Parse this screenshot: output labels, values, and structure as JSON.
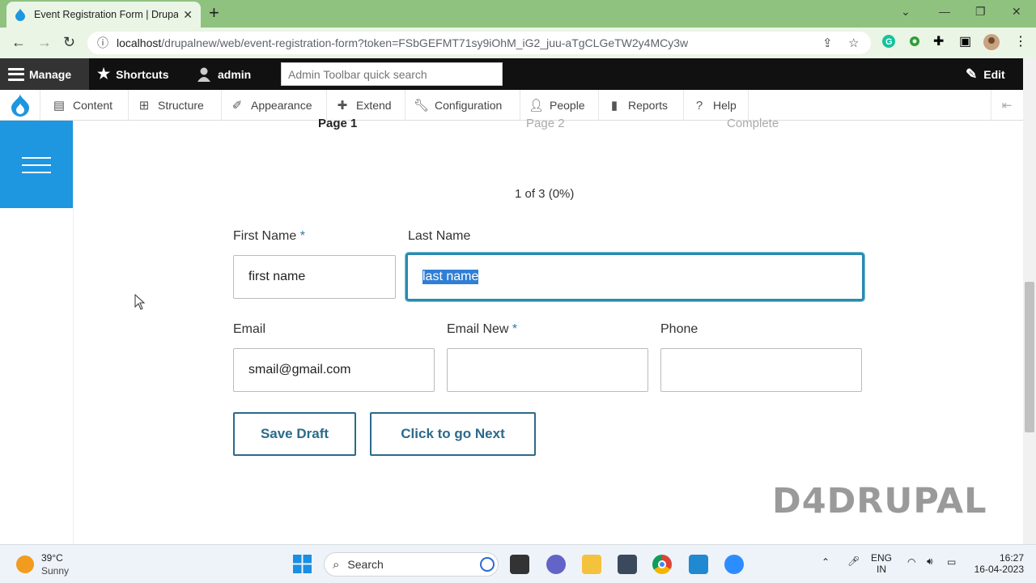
{
  "browser": {
    "tab_title": "Event Registration Form | Drupal",
    "url_host": "localhost",
    "url_rest": "/drupalnew/web/event-registration-form?token=FSbGEFMT71sy9iOhM_iG2_juu-aTgCLGeTW2y4MCy3w"
  },
  "toolbar": {
    "manage": "Manage",
    "shortcuts": "Shortcuts",
    "user": "admin",
    "search_placeholder": "Admin Toolbar quick search",
    "edit": "Edit"
  },
  "subtoolbar": {
    "items": [
      "Content",
      "Structure",
      "Appearance",
      "Extend",
      "Configuration",
      "People",
      "Reports",
      "Help"
    ]
  },
  "progress": {
    "steps": [
      "Page 1",
      "Page 2",
      "Complete"
    ],
    "status": "1 of 3 (0%)"
  },
  "form": {
    "first_name_label": "First Name",
    "first_name_value": "first name",
    "last_name_label": "Last Name",
    "last_name_value": "last name",
    "email_label": "Email",
    "email_value": "smail@gmail.com",
    "email_new_label": "Email New",
    "email_new_value": "",
    "phone_label": "Phone",
    "phone_value": "",
    "required_marker": "*",
    "save_draft": "Save Draft",
    "next": "Click to go Next"
  },
  "watermark": "D4DRUPAL",
  "taskbar": {
    "temp": "39°C",
    "weather": "Sunny",
    "search": "Search",
    "lang_top": "ENG",
    "lang_bottom": "IN",
    "time": "16:27",
    "date": "16-04-2023"
  },
  "colors": {
    "tab_strip": "#8fc27f",
    "drupal_blue": "#1e96e0",
    "focus_ring": "#2b8ab0",
    "button_text": "#2b6a8a"
  }
}
